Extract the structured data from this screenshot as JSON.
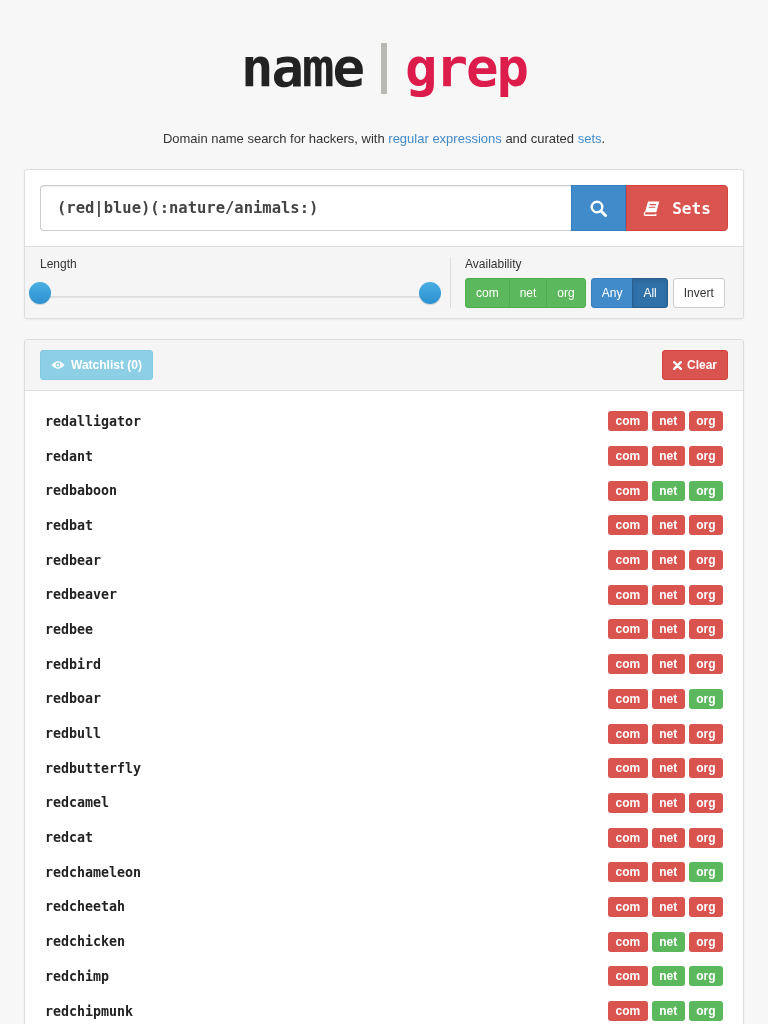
{
  "logo": {
    "left": "name",
    "right": "grep"
  },
  "tagline": [
    {
      "kind": "text",
      "text": "Domain name search for hackers, with "
    },
    {
      "kind": "link",
      "text": "regular expressions"
    },
    {
      "kind": "text",
      "text": " and curated "
    },
    {
      "kind": "link",
      "text": "sets"
    },
    {
      "kind": "text",
      "text": "."
    }
  ],
  "search": {
    "value": "(red|blue)(:nature/animals:)"
  },
  "sets_button": {
    "label": "Sets"
  },
  "length": {
    "label": "Length",
    "thumbs": [
      {
        "level": 0
      },
      {
        "level": 1
      }
    ]
  },
  "availability": {
    "label": "Availability",
    "tlds": [
      {
        "label": "com",
        "on": true
      },
      {
        "label": "net",
        "on": true
      },
      {
        "label": "org",
        "on": true
      }
    ],
    "modes": [
      {
        "label": "Any",
        "selected": false
      },
      {
        "label": "All",
        "selected": true
      }
    ],
    "invert": {
      "label": "Invert"
    }
  },
  "watchlist": {
    "label": "Watchlist (0)",
    "disabled": true
  },
  "clear_button": {
    "label": "Clear"
  },
  "results": [
    {
      "name": "redalligator",
      "domains": [
        {
          "tld": "com",
          "available": false
        },
        {
          "tld": "net",
          "available": false
        },
        {
          "tld": "org",
          "available": false
        }
      ]
    },
    {
      "name": "redant",
      "domains": [
        {
          "tld": "com",
          "available": false
        },
        {
          "tld": "net",
          "available": false
        },
        {
          "tld": "org",
          "available": false
        }
      ]
    },
    {
      "name": "redbaboon",
      "domains": [
        {
          "tld": "com",
          "available": false
        },
        {
          "tld": "net",
          "available": true
        },
        {
          "tld": "org",
          "available": true
        }
      ]
    },
    {
      "name": "redbat",
      "domains": [
        {
          "tld": "com",
          "available": false
        },
        {
          "tld": "net",
          "available": false
        },
        {
          "tld": "org",
          "available": false
        }
      ]
    },
    {
      "name": "redbear",
      "domains": [
        {
          "tld": "com",
          "available": false
        },
        {
          "tld": "net",
          "available": false
        },
        {
          "tld": "org",
          "available": false
        }
      ]
    },
    {
      "name": "redbeaver",
      "domains": [
        {
          "tld": "com",
          "available": false
        },
        {
          "tld": "net",
          "available": false
        },
        {
          "tld": "org",
          "available": false
        }
      ]
    },
    {
      "name": "redbee",
      "domains": [
        {
          "tld": "com",
          "available": false
        },
        {
          "tld": "net",
          "available": false
        },
        {
          "tld": "org",
          "available": false
        }
      ]
    },
    {
      "name": "redbird",
      "domains": [
        {
          "tld": "com",
          "available": false
        },
        {
          "tld": "net",
          "available": false
        },
        {
          "tld": "org",
          "available": false
        }
      ]
    },
    {
      "name": "redboar",
      "domains": [
        {
          "tld": "com",
          "available": false
        },
        {
          "tld": "net",
          "available": false
        },
        {
          "tld": "org",
          "available": true
        }
      ]
    },
    {
      "name": "redbull",
      "domains": [
        {
          "tld": "com",
          "available": false
        },
        {
          "tld": "net",
          "available": false
        },
        {
          "tld": "org",
          "available": false
        }
      ]
    },
    {
      "name": "redbutterfly",
      "domains": [
        {
          "tld": "com",
          "available": false
        },
        {
          "tld": "net",
          "available": false
        },
        {
          "tld": "org",
          "available": false
        }
      ]
    },
    {
      "name": "redcamel",
      "domains": [
        {
          "tld": "com",
          "available": false
        },
        {
          "tld": "net",
          "available": false
        },
        {
          "tld": "org",
          "available": false
        }
      ]
    },
    {
      "name": "redcat",
      "domains": [
        {
          "tld": "com",
          "available": false
        },
        {
          "tld": "net",
          "available": false
        },
        {
          "tld": "org",
          "available": false
        }
      ]
    },
    {
      "name": "redchameleon",
      "domains": [
        {
          "tld": "com",
          "available": false
        },
        {
          "tld": "net",
          "available": false
        },
        {
          "tld": "org",
          "available": true
        }
      ]
    },
    {
      "name": "redcheetah",
      "domains": [
        {
          "tld": "com",
          "available": false
        },
        {
          "tld": "net",
          "available": false
        },
        {
          "tld": "org",
          "available": false
        }
      ]
    },
    {
      "name": "redchicken",
      "domains": [
        {
          "tld": "com",
          "available": false
        },
        {
          "tld": "net",
          "available": true
        },
        {
          "tld": "org",
          "available": false
        }
      ]
    },
    {
      "name": "redchimp",
      "domains": [
        {
          "tld": "com",
          "available": false
        },
        {
          "tld": "net",
          "available": true
        },
        {
          "tld": "org",
          "available": true
        }
      ]
    },
    {
      "name": "redchipmunk",
      "domains": [
        {
          "tld": "com",
          "available": false
        },
        {
          "tld": "net",
          "available": true
        },
        {
          "tld": "org",
          "available": true
        }
      ]
    }
  ]
}
